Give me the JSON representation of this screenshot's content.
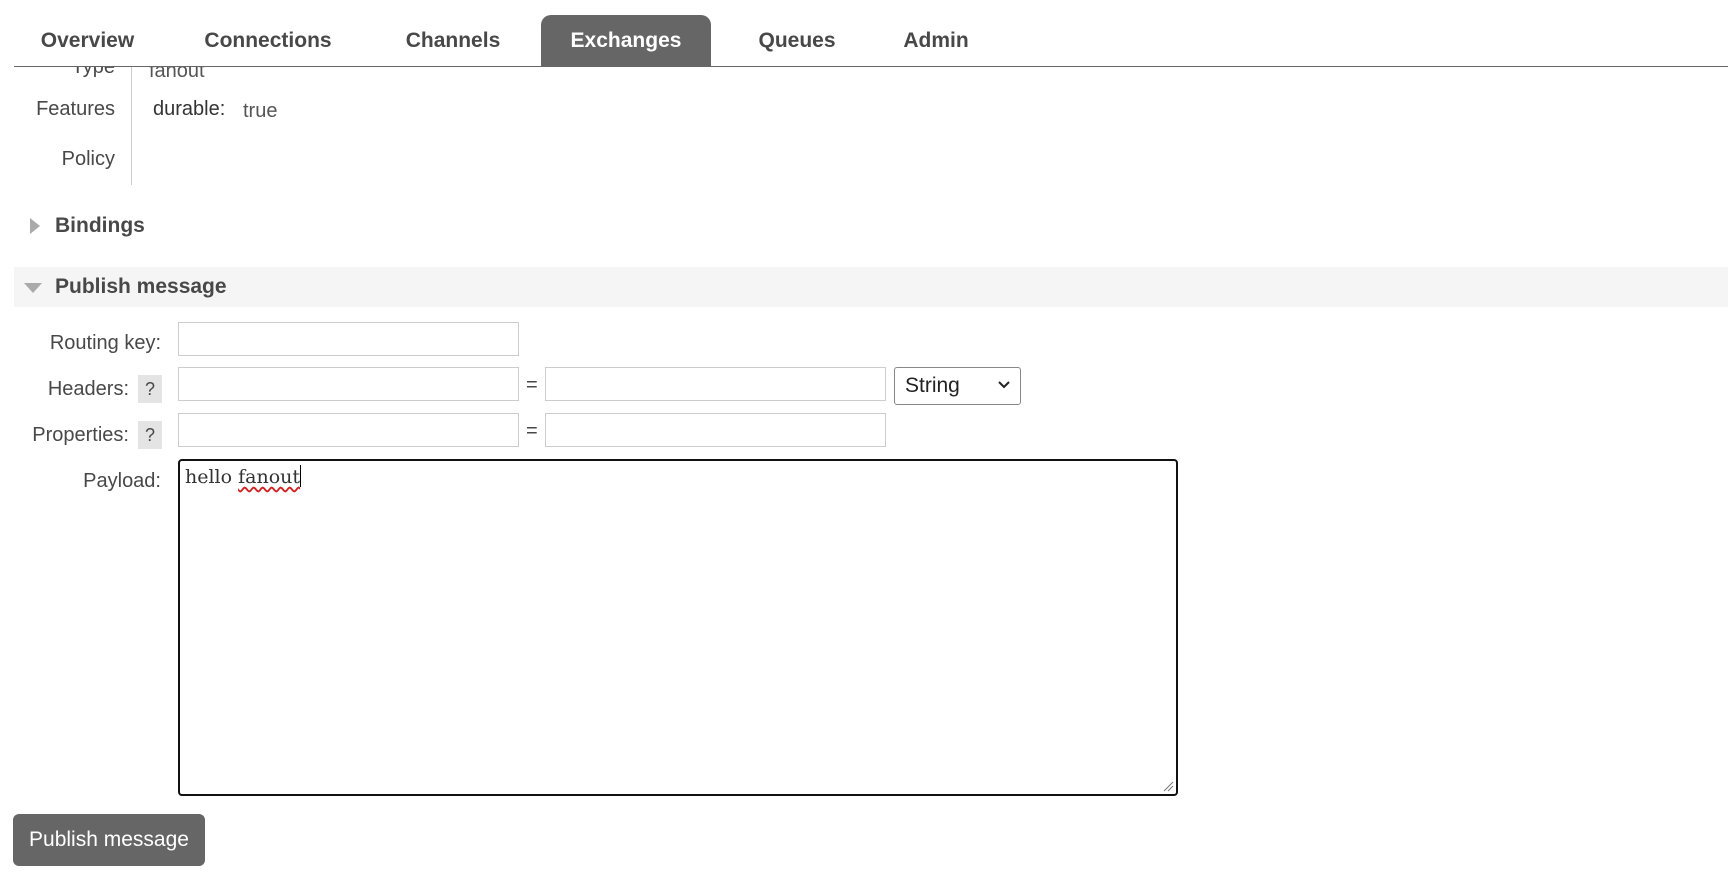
{
  "nav": {
    "tabs": [
      {
        "label": "Overview"
      },
      {
        "label": "Connections"
      },
      {
        "label": "Channels"
      },
      {
        "label": "Exchanges",
        "active": true
      },
      {
        "label": "Queues"
      },
      {
        "label": "Admin"
      }
    ]
  },
  "exchange_info": {
    "type_label": "Type",
    "type_value": "fanout",
    "features_label": "Features",
    "features_key": "durable:",
    "features_value": "true",
    "policy_label": "Policy"
  },
  "bindings": {
    "title": "Bindings",
    "expanded": false
  },
  "publish": {
    "title": "Publish message",
    "expanded": true,
    "routing_key_label": "Routing key:",
    "routing_key_value": "",
    "headers_label": "Headers:",
    "properties_label": "Properties:",
    "help_label": "?",
    "equals": "=",
    "header_type_value": "String",
    "payload_label": "Payload:",
    "payload_word1": "hello",
    "payload_word2": "fanout",
    "button_label": "Publish message"
  },
  "icons": {
    "bindings_caret": "caret-right-icon",
    "publish_caret": "caret-down-icon",
    "select_chevron": "chevron-down-icon",
    "resize": "resize-grip-icon"
  },
  "colors": {
    "tab_active_bg": "#666666",
    "button_bg": "#666666",
    "text": "#484848",
    "section_bg": "#f5f5f5"
  }
}
